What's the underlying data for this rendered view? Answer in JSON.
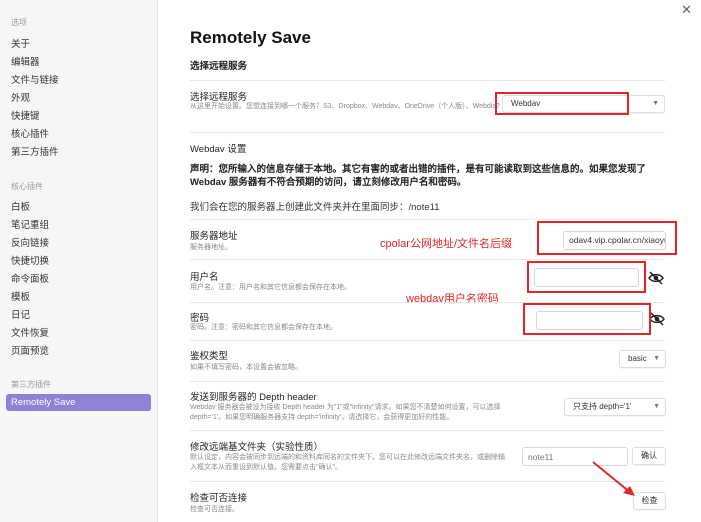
{
  "sidebar": {
    "section_options": "选项",
    "options_items": [
      "关于",
      "编辑器",
      "文件与链接",
      "外观",
      "快捷键",
      "核心插件",
      "第三方插件"
    ],
    "section_core": "核心插件",
    "core_items": [
      "白板",
      "笔记重组",
      "反向链接",
      "快捷切换",
      "命令面板",
      "模板",
      "日记",
      "文件恢复",
      "页面预览"
    ],
    "section_third": "第三方插件",
    "active_item": "Remotely Save"
  },
  "main": {
    "title": "Remotely Save",
    "choose_service_heading": "选择远程服务",
    "choose_service": {
      "name": "选择远程服务",
      "desc": "从这里开始设置。您想连接到哪一个服务？S3、Dropbox、Webdav、OneDrive（个人版）、Webdis?",
      "value": "Webdav"
    },
    "webdav_heading": "Webdav 设置",
    "warning": "声明：您所输入的信息存储于本地。其它有害的或者出错的插件，是有可能读取到这些信息的。如果您发现了 Webdav 服务器有不符合预期的访问，请立刻修改用户名和密码。",
    "folder_note": "我们会在您的服务器上创建此文件夹并在里面同步：/note11",
    "server": {
      "name": "服务器地址",
      "desc": "服务器地址。",
      "value": "odav4.vip.cpolar.cn/xiaoyu"
    },
    "username": {
      "name": "用户名",
      "desc": "用户名。注意：用户名和其它信息都会保存在本地。",
      "value": ""
    },
    "password": {
      "name": "密码",
      "desc": "密码。注意：密码和其它信息都会保存在本地。",
      "value": ""
    },
    "auth": {
      "name": "鉴权类型",
      "desc": "如果不填写密码，本设置会被忽略。",
      "value": "basic"
    },
    "depth": {
      "name": "发送到服务器的 Depth header",
      "desc": "Webdav 服务器会被设为接收 Depth header 为\"1\"或\"infinity\"请求。如果您不清楚如何设置，可以选择 depth='1'。如果您明确服务器支持 depth='infinity'，请选择它，会获得更加好的性能。",
      "value": "只支持 depth='1'"
    },
    "override_folder": {
      "name": "修改远端基文件夹（实验性质）",
      "desc": "默认设定，内容会被同步到远端的和资料库同名的文件夹下。您可以在此修改远端文件夹名，或删除输入框文本从而重设到默认值。您需要点击\"确认\"。",
      "placeholder": "note11",
      "confirm_label": "确认"
    },
    "check": {
      "name": "检查可否连接",
      "desc": "检查可否连接。",
      "button_label": "检查"
    }
  },
  "annotations": {
    "server_hint": "cpolar公网地址/文件名后缀",
    "user_hint": "webdav用户名密码",
    "color": "#e32525"
  },
  "colors": {
    "accent": "#8d82d6",
    "sidebar_bg": "#f6f6f6"
  }
}
